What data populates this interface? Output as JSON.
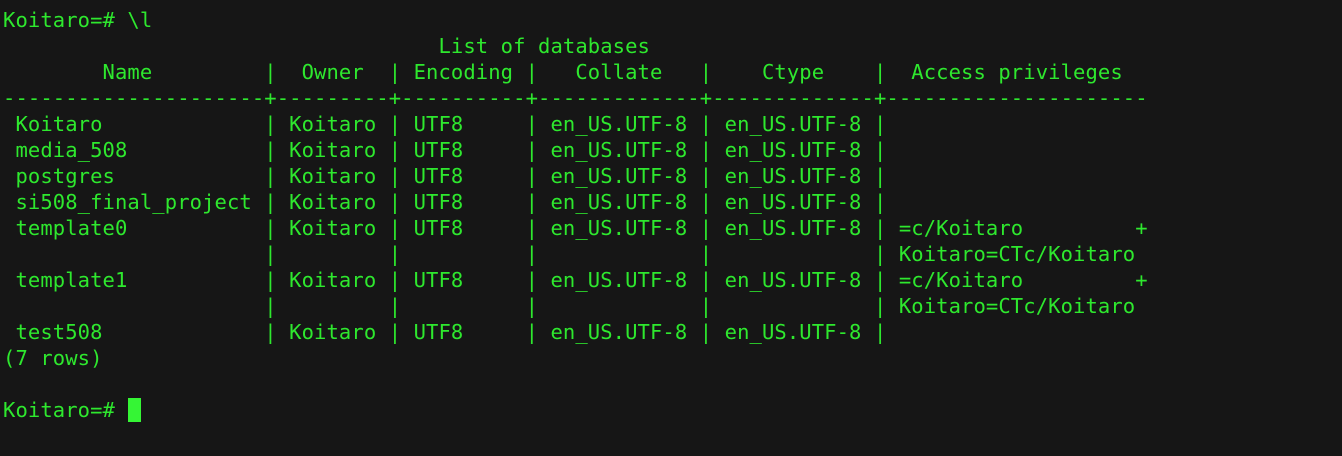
{
  "terminal": {
    "prompt": "Koitaro=# ",
    "command": "\\l",
    "lines": [
      "                                   List of databases",
      "        Name         |  Owner  | Encoding |   Collate   |    Ctype    |  Access privileges",
      "---------------------+---------+----------+-------------+-------------+---------------------",
      " Koitaro             | Koitaro | UTF8     | en_US.UTF-8 | en_US.UTF-8 |",
      " media_508           | Koitaro | UTF8     | en_US.UTF-8 | en_US.UTF-8 |",
      " postgres            | Koitaro | UTF8     | en_US.UTF-8 | en_US.UTF-8 |",
      " si508_final_project | Koitaro | UTF8     | en_US.UTF-8 | en_US.UTF-8 |",
      " template0           | Koitaro | UTF8     | en_US.UTF-8 | en_US.UTF-8 | =c/Koitaro         +",
      "                     |         |          |             |             | Koitaro=CTc/Koitaro",
      " template1           | Koitaro | UTF8     | en_US.UTF-8 | en_US.UTF-8 | =c/Koitaro         +",
      "                     |         |          |             |             | Koitaro=CTc/Koitaro",
      " test508             | Koitaro | UTF8     | en_US.UTF-8 | en_US.UTF-8 |",
      "(7 rows)",
      ""
    ],
    "final_prompt": "Koitaro=# "
  },
  "colors": {
    "text": "#2ee82e",
    "background": "#161616",
    "cursor": "#35f535"
  }
}
